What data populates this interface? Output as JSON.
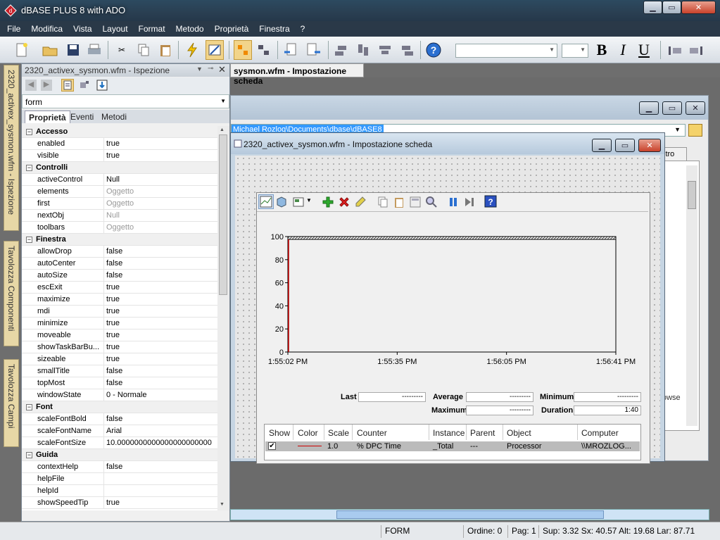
{
  "window": {
    "title": "dBASE PLUS 8 with ADO"
  },
  "menu": [
    "File",
    "Modifica",
    "Vista",
    "Layout",
    "Format",
    "Metodo",
    "Proprietà",
    "Finestra",
    "?"
  ],
  "toolbar": {
    "font_name_value": "",
    "font_size_value": "",
    "bold": "B",
    "italic": "I",
    "underline": "U",
    "help": "?"
  },
  "side_tabs": [
    "2320_activex_sysmon.wfm - Ispezione",
    "Tavolozza Componenti",
    "Tavolozza Campi"
  ],
  "inspector": {
    "title": "2320_activex_sysmon.wfm - Ispezione",
    "object": "form",
    "tabs": [
      "Proprietà",
      "Eventi",
      "Metodi"
    ],
    "categories": [
      {
        "name": "Accesso",
        "props": [
          [
            "enabled",
            "true",
            false
          ],
          [
            "visible",
            "true",
            false
          ]
        ]
      },
      {
        "name": "Controlli",
        "props": [
          [
            "activeControl",
            "Null",
            false
          ],
          [
            "elements",
            "Oggetto",
            true
          ],
          [
            "first",
            "Oggetto",
            true
          ],
          [
            "nextObj",
            "Null",
            true
          ],
          [
            "toolbars",
            "Oggetto",
            true
          ]
        ]
      },
      {
        "name": "Finestra",
        "props": [
          [
            "allowDrop",
            "false",
            false
          ],
          [
            "autoCenter",
            "false",
            false
          ],
          [
            "autoSize",
            "false",
            false
          ],
          [
            "escExit",
            "true",
            false
          ],
          [
            "maximize",
            "true",
            false
          ],
          [
            "mdi",
            "true",
            false
          ],
          [
            "minimize",
            "true",
            false
          ],
          [
            "moveable",
            "true",
            false
          ],
          [
            "showTaskBarBu...",
            "true",
            false
          ],
          [
            "sizeable",
            "true",
            false
          ],
          [
            "smallTitle",
            "false",
            false
          ],
          [
            "topMost",
            "false",
            false
          ],
          [
            "windowState",
            "0 - Normale",
            false
          ]
        ]
      },
      {
        "name": "Font",
        "props": [
          [
            "scaleFontBold",
            "false",
            false
          ],
          [
            "scaleFontName",
            "Arial",
            false
          ],
          [
            "scaleFontSize",
            "10.0000000000000000000000",
            false
          ]
        ]
      },
      {
        "name": "Guida",
        "props": [
          [
            "contextHelp",
            "false",
            false
          ],
          [
            "helpFile",
            "",
            false
          ],
          [
            "helpId",
            "",
            false
          ],
          [
            "showSpeedTip",
            "true",
            false
          ]
        ]
      }
    ]
  },
  "designer": {
    "doc_tab": "sysmon.wfm - Impostazione scheda",
    "back_path": "Michael Rozlog\\Documents\\dbase\\dBASE8",
    "back_tab": "ltro",
    "back_fragment": "owse",
    "front_title": "2320_activex_sysmon.wfm - Impostazione scheda"
  },
  "chart_data": {
    "type": "line",
    "yticks": [
      "100",
      "80",
      "60",
      "40",
      "20",
      "0"
    ],
    "xticks": [
      "1:55:02 PM",
      "1:55:35 PM",
      "1:56:05 PM",
      "1:56:41 PM"
    ],
    "ylim": [
      0,
      100
    ],
    "series": [
      {
        "name": "% DPC Time",
        "color": "#cc0000",
        "values": [
          0
        ]
      }
    ]
  },
  "stats": {
    "last_label": "Last",
    "last_value": "---------",
    "average_label": "Average",
    "average_value": "---------",
    "minimum_label": "Minimum",
    "minimum_value": "---------",
    "maximum_label": "Maximum",
    "maximum_value": "---------",
    "duration_label": "Duration",
    "duration_value": "1:40"
  },
  "counter_table": {
    "headers": [
      "Show",
      "Color",
      "Scale",
      "Counter",
      "Instance",
      "Parent",
      "Object",
      "Computer"
    ],
    "row": {
      "show": "✔",
      "scale": "1.0",
      "counter": "% DPC Time",
      "instance": "_Total",
      "parent": "---",
      "object": "Processor",
      "computer": "\\\\MROZLOG..."
    }
  },
  "status": {
    "mode": "FORM",
    "order": "Ordine: 0",
    "page": "Pag: 1",
    "metrics": "Sup: 3.32 Sx: 40.57 Alt: 19.68 Lar: 87.71"
  }
}
